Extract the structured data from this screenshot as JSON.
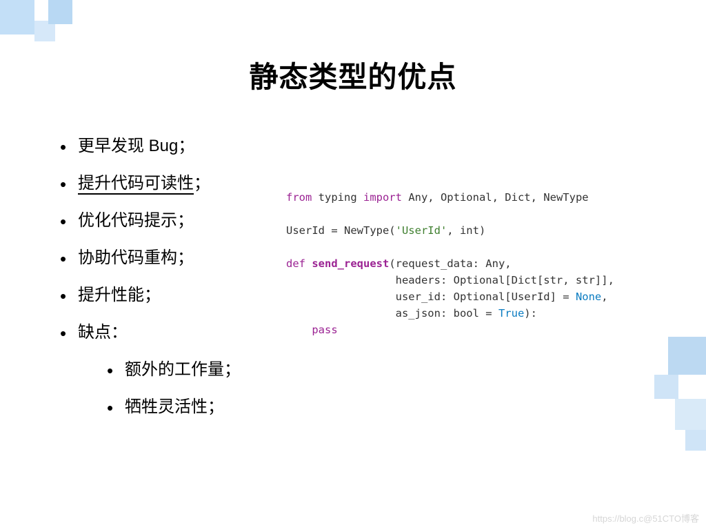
{
  "title": "静态类型的优点",
  "bullets": [
    {
      "text": "更早发现 Bug；",
      "underline": false
    },
    {
      "text": "提升代码可读性",
      "tail": "；",
      "underline": true
    },
    {
      "text": "优化代码提示；",
      "underline": false
    },
    {
      "text": "协助代码重构；",
      "underline": false
    },
    {
      "text": "提升性能；",
      "underline": false
    },
    {
      "text": "缺点：",
      "underline": false,
      "children": [
        {
          "text": "额外的工作量；"
        },
        {
          "text": "牺牲灵活性；"
        }
      ]
    }
  ],
  "code": {
    "l1_from": "from",
    "l1_mod": " typing ",
    "l1_import": "import",
    "l1_rest": " Any, Optional, Dict, NewType",
    "l2_lhs": "UserId = NewType(",
    "l2_str": "'UserId'",
    "l2_rhs": ", int)",
    "l3_def": "def",
    "l3_sp": " ",
    "l3_fn": "send_request",
    "l3_sig": "(request_data: Any,",
    "l4": "                 headers: Optional[Dict[str, str]],",
    "l5_pre": "                 user_id: Optional[UserId] = ",
    "l5_none": "None",
    "l5_post": ",",
    "l6_pre": "                 as_json: bool = ",
    "l6_true": "True",
    "l6_post": "):",
    "l7_indent": "    ",
    "l7_pass": "pass"
  },
  "watermark": "https://blog.c@51CTO博客"
}
